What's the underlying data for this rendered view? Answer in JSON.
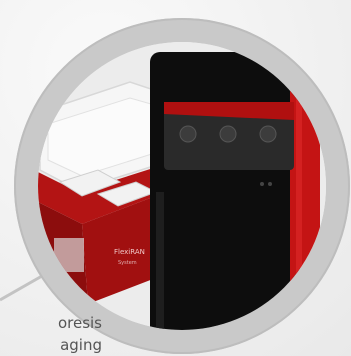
{
  "caption": {
    "line1": "oresis",
    "line2": "aging"
  },
  "product": {
    "label_main": "FlexiRAN",
    "label_sub": "System"
  },
  "colors": {
    "ring": "#c9c9c9",
    "device_body": "#0d0d0d",
    "accent_red": "#c41414",
    "screen_red": "#b01010",
    "caption_text": "#555555"
  }
}
